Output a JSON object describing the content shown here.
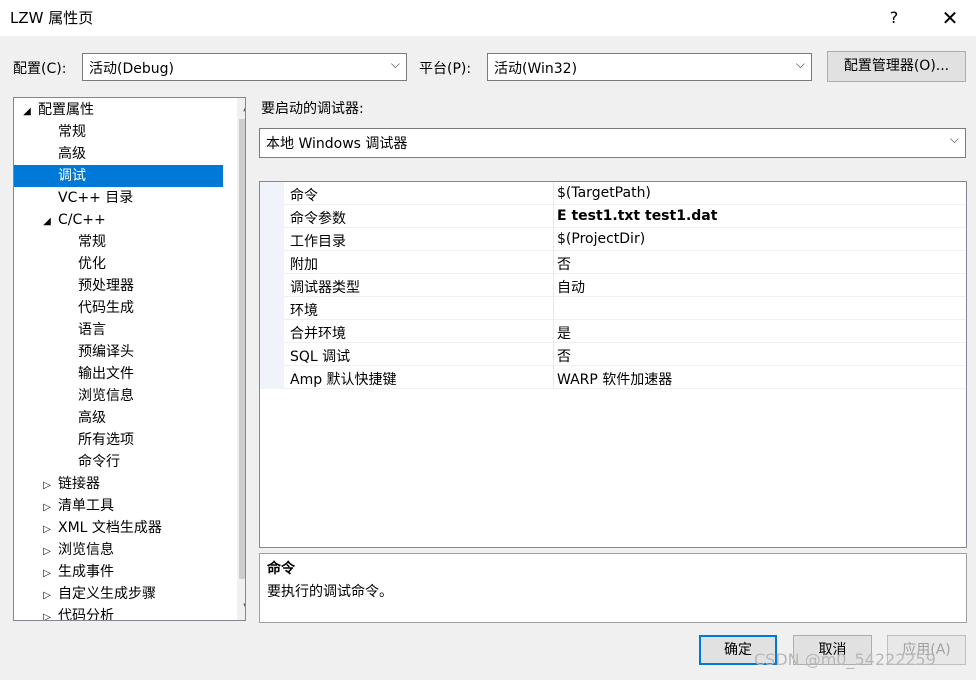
{
  "window": {
    "title": "LZW 属性页",
    "help_label": "?",
    "close_label": "✕"
  },
  "toolbar": {
    "config_label": "配置(C):",
    "config_value": "活动(Debug)",
    "platform_label": "平台(P):",
    "platform_value": "活动(Win32)",
    "config_manager_label": "配置管理器(O)..."
  },
  "tree": {
    "items": [
      {
        "label": "配置属性",
        "expander": "◢"
      },
      {
        "label": "常规",
        "expander": ""
      },
      {
        "label": "高级",
        "expander": ""
      },
      {
        "label": "调试",
        "expander": ""
      },
      {
        "label": "VC++ 目录",
        "expander": ""
      },
      {
        "label": "C/C++",
        "expander": "◢"
      },
      {
        "label": "常规",
        "expander": ""
      },
      {
        "label": "优化",
        "expander": ""
      },
      {
        "label": "预处理器",
        "expander": ""
      },
      {
        "label": "代码生成",
        "expander": ""
      },
      {
        "label": "语言",
        "expander": ""
      },
      {
        "label": "预编译头",
        "expander": ""
      },
      {
        "label": "输出文件",
        "expander": ""
      },
      {
        "label": "浏览信息",
        "expander": ""
      },
      {
        "label": "高级",
        "expander": ""
      },
      {
        "label": "所有选项",
        "expander": ""
      },
      {
        "label": "命令行",
        "expander": ""
      },
      {
        "label": "链接器",
        "expander": "▷"
      },
      {
        "label": "清单工具",
        "expander": "▷"
      },
      {
        "label": "XML 文档生成器",
        "expander": "▷"
      },
      {
        "label": "浏览信息",
        "expander": "▷"
      },
      {
        "label": "生成事件",
        "expander": "▷"
      },
      {
        "label": "自定义生成步骤",
        "expander": "▷"
      },
      {
        "label": "代码分析",
        "expander": "▷"
      }
    ],
    "selected": "调试"
  },
  "debugger": {
    "label": "要启动的调试器:",
    "value": "本地 Windows 调试器"
  },
  "properties": [
    {
      "name": "命令",
      "value": "$(TargetPath)"
    },
    {
      "name": "命令参数",
      "value": "E test1.txt test1.dat"
    },
    {
      "name": "工作目录",
      "value": "$(ProjectDir)"
    },
    {
      "name": "附加",
      "value": "否"
    },
    {
      "name": "调试器类型",
      "value": "自动"
    },
    {
      "name": "环境",
      "value": ""
    },
    {
      "name": "合并环境",
      "value": "是"
    },
    {
      "name": "SQL 调试",
      "value": "否"
    },
    {
      "name": "Amp 默认快捷键",
      "value": "WARP 软件加速器"
    }
  ],
  "description": {
    "title": "命令",
    "text": "要执行的调试命令。"
  },
  "footer": {
    "ok_label": "确定",
    "cancel_label": "取消",
    "apply_label": "应用(A)"
  },
  "watermark": "CSDN @m0_54222259",
  "colors": {
    "selection": "#0078d7",
    "accent_border": "#0078d7"
  }
}
